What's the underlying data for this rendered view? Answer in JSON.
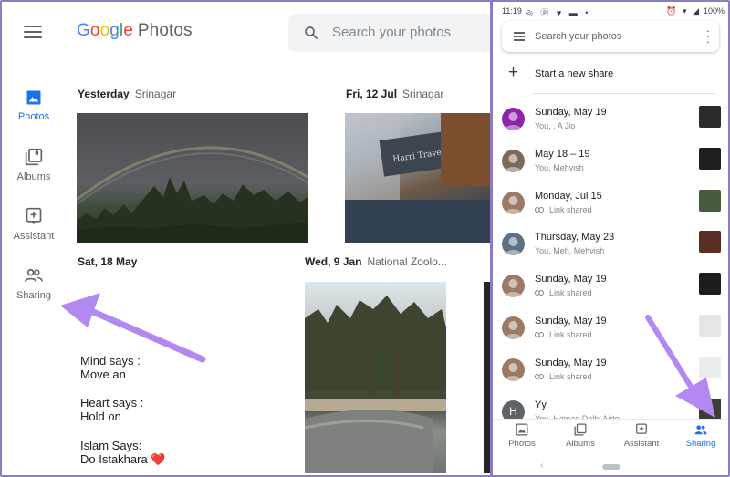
{
  "desktop": {
    "brand": {
      "g": "G",
      "o1": "o",
      "o2": "o",
      "g2": "g",
      "l": "l",
      "e": "e",
      "suffix": "Photos"
    },
    "search_placeholder": "Search your photos",
    "nav": [
      {
        "label": "Photos",
        "icon": "photo-icon",
        "active": true
      },
      {
        "label": "Albums",
        "icon": "album-icon",
        "active": false
      },
      {
        "label": "Assistant",
        "icon": "assistant-icon",
        "active": false
      },
      {
        "label": "Sharing",
        "icon": "people-icon",
        "active": false
      }
    ],
    "sections": [
      {
        "date": "Yesterday",
        "location": "Srinagar"
      },
      {
        "date": "Fri, 12 Jul",
        "location": "Srinagar"
      },
      {
        "date": "Sat, 18 May",
        "location": ""
      },
      {
        "date": "Wed, 9 Jan",
        "location": "National Zoolo..."
      }
    ],
    "quote": {
      "l1": "Mind says :",
      "l2": "Move an",
      "l3": "Heart says :",
      "l4": "Hold on",
      "l5": "Islam Says:",
      "l6": "Do Istakhara",
      "heart": "❤️"
    }
  },
  "phone": {
    "status": {
      "time": "11:19",
      "left_icons": "◎ ⓟ ♥ ▬ •",
      "right_icons": "⏰ ▾ ◢",
      "battery": "100%"
    },
    "search_placeholder": "Search your photos",
    "new_share_label": "Start a new share",
    "shares": [
      {
        "title": "Sunday, May 19",
        "sub": "You, . A Jio",
        "link": false,
        "avatar_color": "#8e24aa",
        "thumb": "#2b2b2b"
      },
      {
        "title": "May 18 – 19",
        "sub": "You, Mehvish",
        "link": false,
        "avatar_color": "#7b6a5a",
        "thumb": "#1f1f1f"
      },
      {
        "title": "Monday, Jul 15",
        "sub": "Link shared",
        "link": true,
        "avatar_color": "#9c7b66",
        "thumb": "#4a5a3c"
      },
      {
        "title": "Thursday, May 23",
        "sub": "You, Meh, Mehvish",
        "link": false,
        "avatar_color": "#5f6f84",
        "thumb": "#5a2e22"
      },
      {
        "title": "Sunday, May 19",
        "sub": "Link shared",
        "link": true,
        "avatar_color": "#9c7b66",
        "thumb": "#1d1d1d"
      },
      {
        "title": "Sunday, May 19",
        "sub": "Link shared",
        "link": true,
        "avatar_color": "#9c7b66",
        "thumb": "#e5e5e5"
      },
      {
        "title": "Sunday, May 19",
        "sub": "Link shared",
        "link": true,
        "avatar_color": "#9c7b66",
        "thumb": "#ececec"
      },
      {
        "title": "Yy",
        "sub": "You, Hamad Delhi Airtel",
        "link": false,
        "avatar_color": "#5f6368",
        "avatar_letter": "H",
        "thumb": "#3a3f36"
      }
    ],
    "bottom_nav": [
      {
        "label": "Photos",
        "icon": "photo-icon",
        "active": false
      },
      {
        "label": "Albums",
        "icon": "album-icon",
        "active": false
      },
      {
        "label": "Assistant",
        "icon": "assistant-icon",
        "active": false
      },
      {
        "label": "Sharing",
        "icon": "people-icon",
        "active": true
      }
    ]
  },
  "colors": {
    "accent": "#1a73e8",
    "annotation_arrow": "#b388f0"
  }
}
